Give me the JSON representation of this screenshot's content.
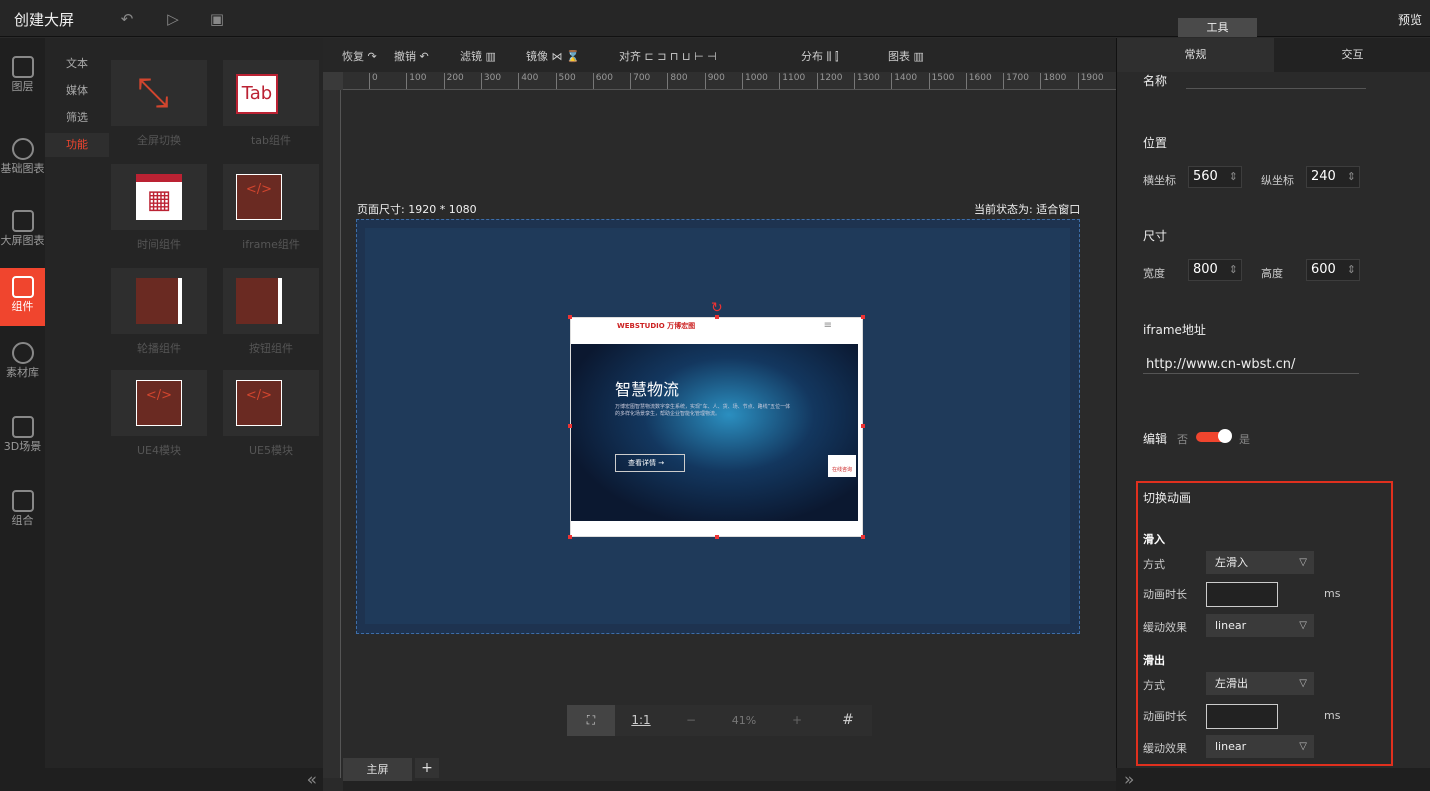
{
  "app": {
    "title": "创建大屏",
    "tools_tab": "工具",
    "preview": "预览"
  },
  "leftnav": [
    {
      "label": "图层",
      "icon": "layers-icon"
    },
    {
      "label": "基础图表",
      "icon": "pie-chart-icon"
    },
    {
      "label": "大屏图表",
      "icon": "monitor-chart-icon"
    },
    {
      "label": "组件",
      "icon": "sliders-icon",
      "active": true
    },
    {
      "label": "素材库",
      "icon": "hexagons-icon"
    },
    {
      "label": "3D场景",
      "icon": "cube-icon"
    },
    {
      "label": "组合",
      "icon": "group-icon"
    }
  ],
  "subnav": [
    {
      "label": "文本"
    },
    {
      "label": "媒体"
    },
    {
      "label": "筛选"
    },
    {
      "label": "功能",
      "active": true
    }
  ],
  "components": [
    {
      "label": "全屏切换",
      "glyph": "⤡"
    },
    {
      "label": "tab组件",
      "glyph": "Tab"
    },
    {
      "label": "时间组件",
      "glyph": "▦"
    },
    {
      "label": "iframe组件",
      "glyph": "</>"
    },
    {
      "label": "轮播组件",
      "glyph": "▭"
    },
    {
      "label": "按钮组件",
      "glyph": "▭"
    },
    {
      "label": "UE4模块",
      "glyph": "</>"
    },
    {
      "label": "UE5模块",
      "glyph": "</>"
    }
  ],
  "toolbar": {
    "redo": "恢复",
    "undo": "撤销",
    "filter": "滤镜",
    "mirror": "镜像",
    "align": "对齐",
    "distribute": "分布",
    "chart": "图表"
  },
  "ruler": {
    "ticks": [
      "0",
      "100",
      "200",
      "300",
      "400",
      "500",
      "600",
      "700",
      "800",
      "900",
      "1000",
      "1100",
      "1200",
      "1300",
      "1400",
      "1500",
      "1600",
      "1700",
      "1800",
      "1900"
    ]
  },
  "canvas": {
    "page_size": "页面尺寸: 1920 * 1080",
    "state": "当前状态为: 适合窗口"
  },
  "iframe_preview": {
    "brand": "WEBSTUDIO 万博宏图",
    "title": "智慧物流",
    "subtitle": "万博宏图智慧物流数字孪生系统，实现“车、人、货、场、节点、路线”五位一体的多样化场景孪生，帮助企业智能化管理物流。",
    "button": "查看详情 →",
    "badge": "在线咨询"
  },
  "zoom": {
    "fit": "⛶",
    "one_to_one": "1:1",
    "minus": "−",
    "level": "41%",
    "plus": "+",
    "grid": "#"
  },
  "screens": {
    "tab": "主屏",
    "add": "+"
  },
  "right_panel": {
    "tabs": [
      "常规",
      "交互"
    ],
    "name_label": "名称",
    "position_label": "位置",
    "x_label": "横坐标",
    "x_value": "560",
    "y_label": "纵坐标",
    "y_value": "240",
    "size_label": "尺寸",
    "w_label": "宽度",
    "w_value": "800",
    "h_label": "高度",
    "h_value": "600",
    "iframe_label": "iframe地址",
    "iframe_url": "http://www.cn-wbst.cn/",
    "edit_label": "编辑",
    "no": "否",
    "yes": "是",
    "anim": {
      "title": "切换动画",
      "in_label": "滑入",
      "in_mode_label": "方式",
      "in_mode": "左滑入",
      "in_dur_label": "动画时长",
      "in_unit": "ms",
      "in_ease_label": "缓动效果",
      "in_ease": "linear",
      "out_label": "滑出",
      "out_mode_label": "方式",
      "out_mode": "左滑出",
      "out_dur_label": "动画时长",
      "out_unit": "ms",
      "out_ease_label": "缓动效果",
      "out_ease": "linear"
    }
  },
  "colors": {
    "accent": "#f0452e",
    "stage": "#1e3350",
    "highlight_border": "#e0301e"
  }
}
